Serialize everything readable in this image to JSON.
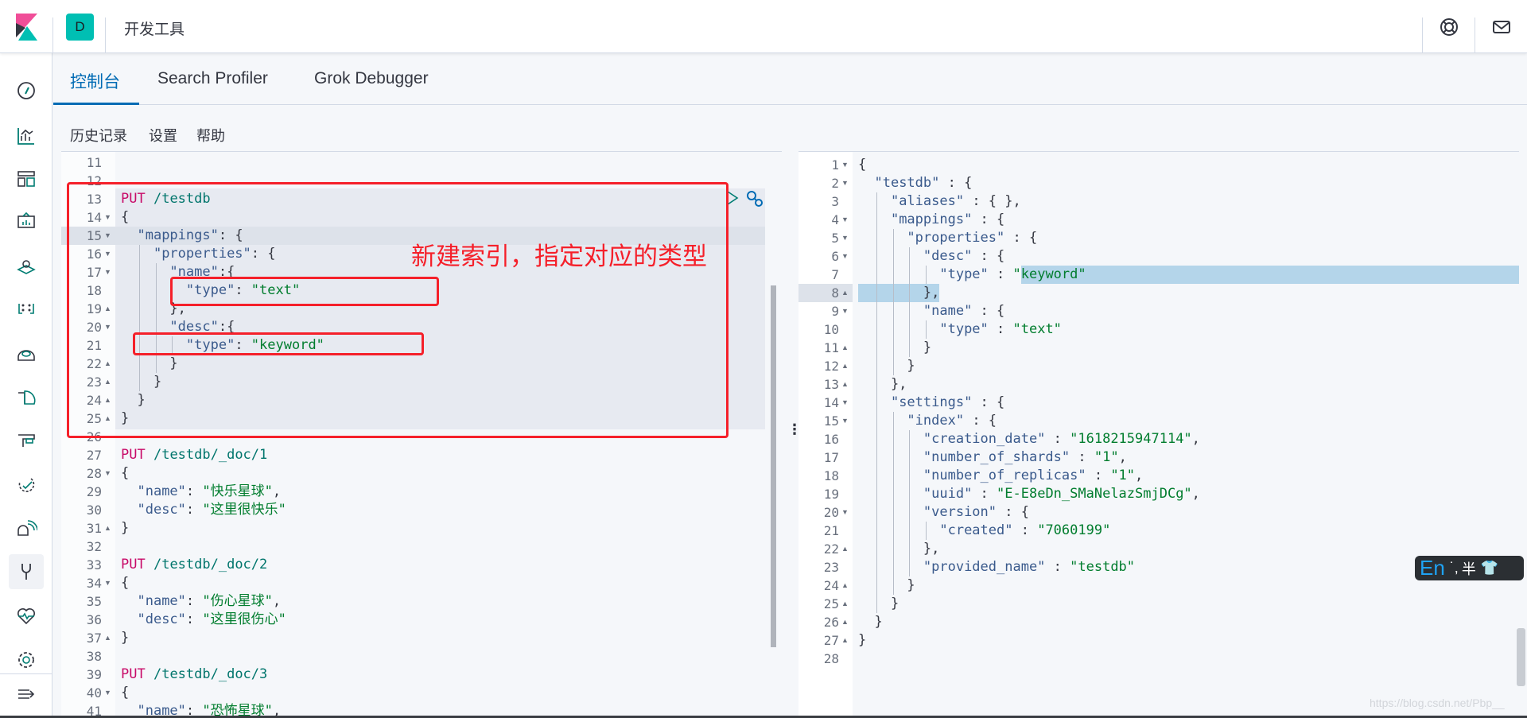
{
  "header": {
    "avatar_letter": "D",
    "app_title": "开发工具",
    "icons": [
      "kibana-logo",
      "help-lifebuoy-icon",
      "mail-icon"
    ]
  },
  "sidebar": {
    "items": [
      "discover",
      "visualize",
      "dashboard",
      "canvas",
      "maps",
      "machine-learning",
      "metrics",
      "logs",
      "apm",
      "uptime",
      "siem",
      "dev-tools",
      "monitoring",
      "management"
    ],
    "active": "dev-tools",
    "collapse_icon": "collapse-menu-icon"
  },
  "tabs": [
    {
      "label": "控制台",
      "active": true
    },
    {
      "label": "Search Profiler",
      "active": false
    },
    {
      "label": "Grok Debugger",
      "active": false
    }
  ],
  "menu": [
    "历史记录",
    "设置",
    "帮助"
  ],
  "colors": {
    "accent": "#006bb4",
    "method": "#c80a68",
    "string": "#017d2e",
    "annotation": "#f5202a",
    "selection": "#b4d5ea"
  },
  "request_editor": {
    "active_line": 15,
    "selected_block": [
      13,
      25
    ],
    "lines": [
      {
        "n": 11,
        "text": "",
        "fold": ""
      },
      {
        "n": 12,
        "text": "",
        "fold": ""
      },
      {
        "n": 13,
        "text": "PUT /testdb",
        "fold": ""
      },
      {
        "n": 14,
        "text": "{",
        "fold": "down"
      },
      {
        "n": 15,
        "text": "  \"mappings\": {",
        "fold": "down"
      },
      {
        "n": 16,
        "text": "    \"properties\": {",
        "fold": "down"
      },
      {
        "n": 17,
        "text": "      \"name\":{",
        "fold": "down"
      },
      {
        "n": 18,
        "text": "        \"type\": \"text\"",
        "fold": ""
      },
      {
        "n": 19,
        "text": "      },",
        "fold": "up"
      },
      {
        "n": 20,
        "text": "      \"desc\":{",
        "fold": "down"
      },
      {
        "n": 21,
        "text": "        \"type\": \"keyword\"",
        "fold": ""
      },
      {
        "n": 22,
        "text": "      }",
        "fold": "up"
      },
      {
        "n": 23,
        "text": "    }",
        "fold": "up"
      },
      {
        "n": 24,
        "text": "  }",
        "fold": "up"
      },
      {
        "n": 25,
        "text": "}",
        "fold": "up"
      },
      {
        "n": 26,
        "text": "",
        "fold": ""
      },
      {
        "n": 27,
        "text": "PUT /testdb/_doc/1",
        "fold": ""
      },
      {
        "n": 28,
        "text": "{",
        "fold": "down"
      },
      {
        "n": 29,
        "text": "  \"name\": \"快乐星球\",",
        "fold": ""
      },
      {
        "n": 30,
        "text": "  \"desc\": \"这里很快乐\"",
        "fold": ""
      },
      {
        "n": 31,
        "text": "}",
        "fold": "up"
      },
      {
        "n": 32,
        "text": "",
        "fold": ""
      },
      {
        "n": 33,
        "text": "PUT /testdb/_doc/2",
        "fold": ""
      },
      {
        "n": 34,
        "text": "{",
        "fold": "down"
      },
      {
        "n": 35,
        "text": "  \"name\": \"伤心星球\",",
        "fold": ""
      },
      {
        "n": 36,
        "text": "  \"desc\": \"这里很伤心\"",
        "fold": ""
      },
      {
        "n": 37,
        "text": "}",
        "fold": "up"
      },
      {
        "n": 38,
        "text": "",
        "fold": ""
      },
      {
        "n": 39,
        "text": "PUT /testdb/_doc/3",
        "fold": ""
      },
      {
        "n": 40,
        "text": "{",
        "fold": "down"
      },
      {
        "n": 41,
        "text": "  \"name\": \"恐怖星球\",",
        "fold": ""
      }
    ],
    "action_icons": [
      "play-icon",
      "wrench-icon"
    ]
  },
  "annotation": "新建索引，指定对应的类型",
  "response_editor": {
    "active_line": 8,
    "selection": {
      "from": [
        7,
        20
      ],
      "to": [
        8,
        10
      ]
    },
    "lines": [
      {
        "n": 1,
        "text": "{",
        "fold": "down"
      },
      {
        "n": 2,
        "text": "  \"testdb\" : {",
        "fold": "down"
      },
      {
        "n": 3,
        "text": "    \"aliases\" : { },",
        "fold": ""
      },
      {
        "n": 4,
        "text": "    \"mappings\" : {",
        "fold": "down"
      },
      {
        "n": 5,
        "text": "      \"properties\" : {",
        "fold": "down"
      },
      {
        "n": 6,
        "text": "        \"desc\" : {",
        "fold": "down"
      },
      {
        "n": 7,
        "text": "          \"type\" : \"keyword\"",
        "fold": ""
      },
      {
        "n": 8,
        "text": "        },",
        "fold": "up"
      },
      {
        "n": 9,
        "text": "        \"name\" : {",
        "fold": "down"
      },
      {
        "n": 10,
        "text": "          \"type\" : \"text\"",
        "fold": ""
      },
      {
        "n": 11,
        "text": "        }",
        "fold": "up"
      },
      {
        "n": 12,
        "text": "      }",
        "fold": "up"
      },
      {
        "n": 13,
        "text": "    },",
        "fold": "up"
      },
      {
        "n": 14,
        "text": "    \"settings\" : {",
        "fold": "down"
      },
      {
        "n": 15,
        "text": "      \"index\" : {",
        "fold": "down"
      },
      {
        "n": 16,
        "text": "        \"creation_date\" : \"1618215947114\",",
        "fold": ""
      },
      {
        "n": 17,
        "text": "        \"number_of_shards\" : \"1\",",
        "fold": ""
      },
      {
        "n": 18,
        "text": "        \"number_of_replicas\" : \"1\",",
        "fold": ""
      },
      {
        "n": 19,
        "text": "        \"uuid\" : \"E-E8eDn_SMaNelazSmjDCg\",",
        "fold": ""
      },
      {
        "n": 20,
        "text": "        \"version\" : {",
        "fold": "down"
      },
      {
        "n": 21,
        "text": "          \"created\" : \"7060199\"",
        "fold": ""
      },
      {
        "n": 22,
        "text": "        },",
        "fold": "up"
      },
      {
        "n": 23,
        "text": "        \"provided_name\" : \"testdb\"",
        "fold": ""
      },
      {
        "n": 24,
        "text": "      }",
        "fold": "up"
      },
      {
        "n": 25,
        "text": "    }",
        "fold": "up"
      },
      {
        "n": 26,
        "text": "  }",
        "fold": "up"
      },
      {
        "n": 27,
        "text": "}",
        "fold": "up"
      },
      {
        "n": 28,
        "text": "",
        "fold": ""
      }
    ]
  },
  "ime": {
    "lang": "En",
    "punct": "˙,",
    "width": "半"
  },
  "watermark": "https://blog.csdn.net/Pbp__"
}
